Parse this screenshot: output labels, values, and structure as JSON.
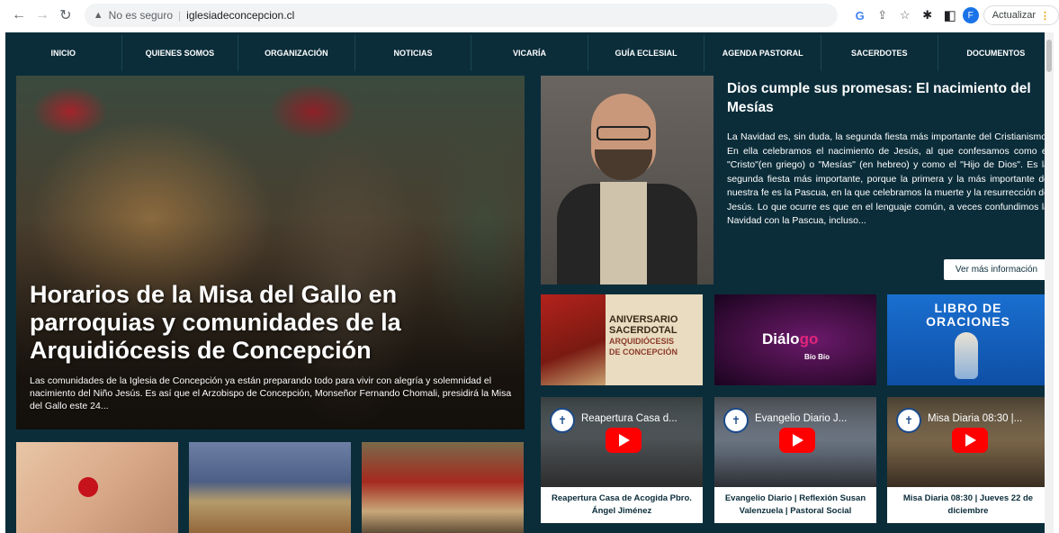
{
  "browser": {
    "security_label": "No es seguro",
    "separator": "|",
    "url": "iglesiadeconcepcion.cl",
    "update_label": "Actualizar",
    "profile_initial": "F",
    "google_label": "G"
  },
  "nav": {
    "items": [
      {
        "label": "INICIO"
      },
      {
        "label": "QUIENES SOMOS"
      },
      {
        "label": "ORGANIZACIÓN"
      },
      {
        "label": "NOTICIAS"
      },
      {
        "label": "VICARÍA"
      },
      {
        "label": "GUÍA ECLESIAL"
      },
      {
        "label": "AGENDA PASTORAL"
      },
      {
        "label": "SACERDOTES"
      },
      {
        "label": "DOCUMENTOS"
      }
    ]
  },
  "hero": {
    "title": "Horarios de la Misa del Gallo en parroquias y comunidades de la Arquidiócesis de Concepción",
    "excerpt": "Las comunidades de la Iglesia de Concepción ya están preparando todo para vivir con alegría y solemnidad el nacimiento del Niño Jesús.  Es así que el Arzobispo de Concepción, Monseñor Fernando Chomali, presidirá la Misa del Gallo este 24..."
  },
  "featured": {
    "title": "Dios cumple sus promesas: El nacimiento del Mesías",
    "body": "La Navidad es, sin duda, la segunda fiesta más importante del Cristianismo. En ella celebramos el nacimiento de Jesús, al que confesamos como el \"Cristo\"(en griego) o \"Mesías\" (en hebreo) y como el \"Hijo de Dios\". Es la segunda fiesta más importante, porque la primera y la más importante de nuestra fe es la Pascua, en la que celebramos la muerte y la resurrección de Jesús. Lo que ocurre es que en el lenguaje común, a veces confundimos la Navidad con la Pascua, incluso...",
    "button_label": "Ver más información"
  },
  "banners": {
    "aniversario": {
      "line1": "ANIVERSARIO",
      "line2": "SACERDOTAL",
      "line3": "ARQUIDIÓCESIS",
      "line4": "DE CONCEPCIÓN"
    },
    "dialogo": {
      "title_a": "Diálo",
      "title_b": "go",
      "subtitle": "Bío Bío"
    },
    "libro": {
      "line1": "LIBRO DE",
      "line2": "ORACIONES"
    }
  },
  "videos": [
    {
      "yt_title": "Reapertura Casa d...",
      "caption": "Reapertura Casa de Acogida Pbro. Ángel Jiménez"
    },
    {
      "yt_title": "Evangelio Diario J...",
      "caption": "Evangelio Diario | Reflexión Susan Valenzuela | Pastoral Social"
    },
    {
      "yt_title": "Misa Diaria 08:30 |...",
      "caption": "Misa Diaria 08:30 | Jueves 22 de diciembre"
    }
  ]
}
